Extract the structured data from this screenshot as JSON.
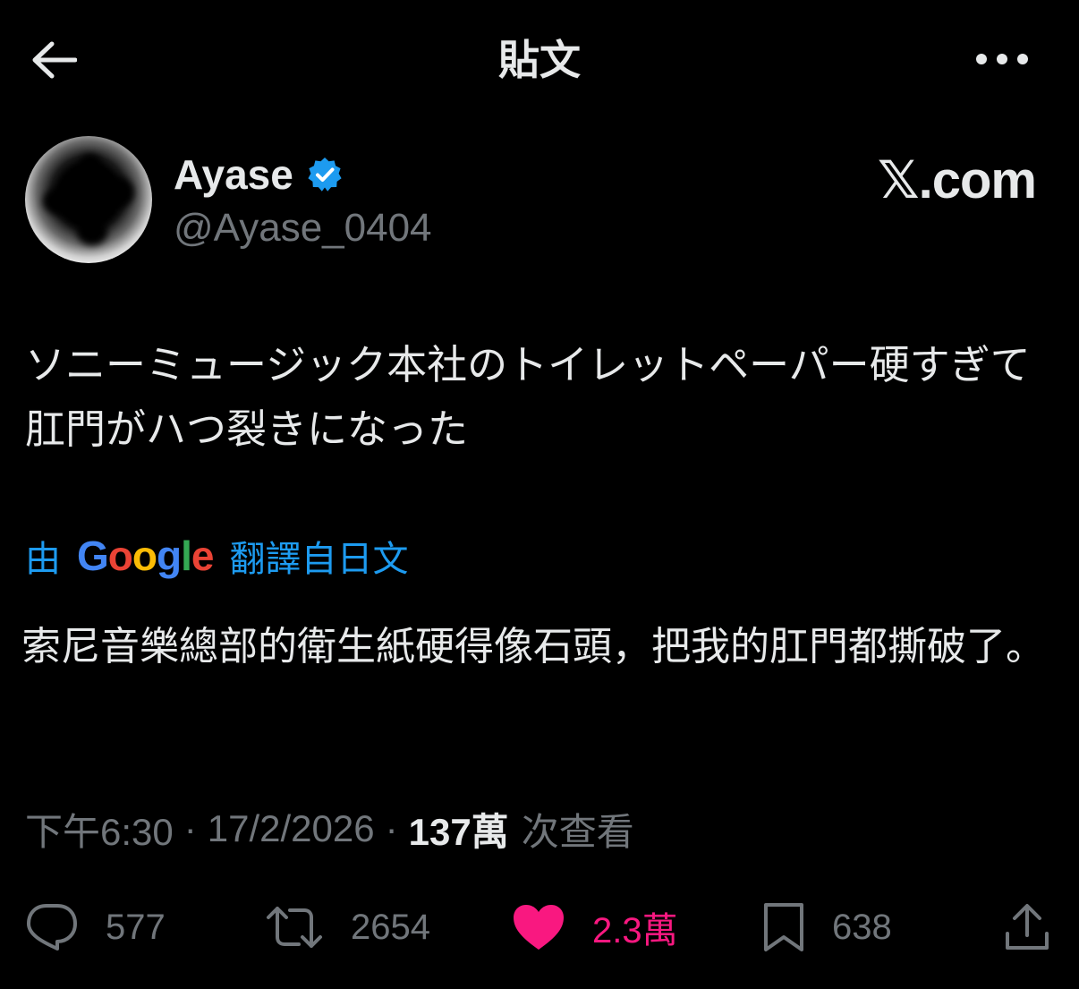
{
  "header": {
    "title": "貼文"
  },
  "author": {
    "display_name": "Ayase",
    "handle": "@Ayase_0404"
  },
  "watermark": "𝕏.com",
  "tweet": {
    "text": "ソニーミュージック本社のトイレットペーパー硬すぎて肛門がハつ裂きになった",
    "translation": {
      "prefix": "由",
      "provider": "Google",
      "suffix": "翻譯自日文",
      "text": "索尼音樂總部的衛生紙硬得像石頭，把我的肛門都撕破了。"
    },
    "time": "下午6:30",
    "date": "17/2/2026",
    "views_count": "137萬",
    "views_label": "次查看"
  },
  "actions": {
    "replies": "577",
    "reposts": "2654",
    "likes": "2.3萬",
    "bookmarks": "638"
  },
  "icons": {
    "back": "arrow-left-icon",
    "more": "more-horizontal-icon",
    "verified": "verified-badge-icon",
    "reply": "reply-icon",
    "repost": "repost-icon",
    "like": "heart-filled-icon",
    "bookmark": "bookmark-icon",
    "share": "share-icon"
  },
  "colors": {
    "background": "#000000",
    "text": "#e7e9ea",
    "secondary": "#71767b",
    "accent": "#1d9bf0",
    "like": "#f91880"
  }
}
